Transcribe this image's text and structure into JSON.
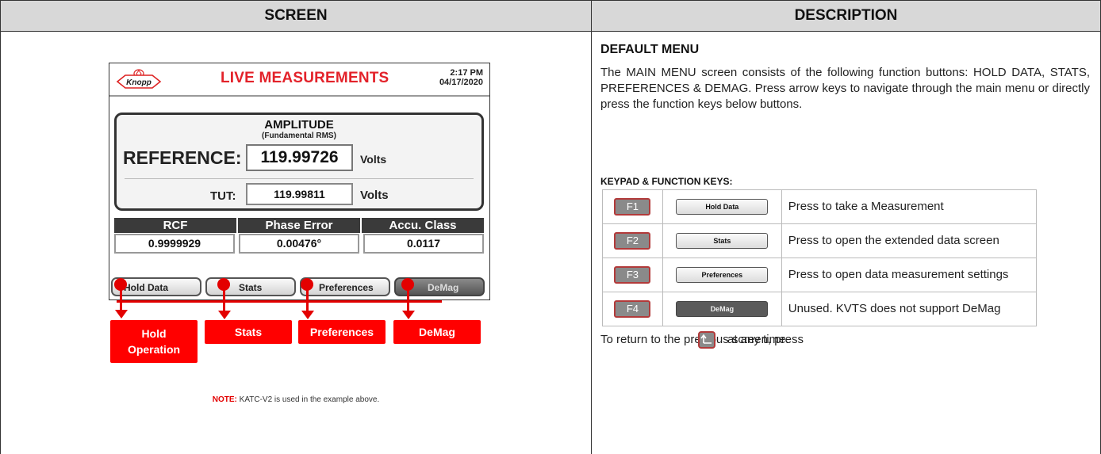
{
  "headers": {
    "screen": "SCREEN",
    "description": "DESCRIPTION"
  },
  "device": {
    "logo_text": "Knopp",
    "title": "LIVE MEASUREMENTS",
    "time": "2:17 PM",
    "date": "04/17/2020",
    "amplitude": {
      "title": "AMPLITUDE",
      "subtitle": "(Fundamental RMS)",
      "reference_label": "REFERENCE:",
      "reference_value": "119.99726",
      "reference_unit": "Volts",
      "tut_label": "TUT:",
      "tut_value": "119.99811",
      "tut_unit": "Volts"
    },
    "metrics": {
      "headers": [
        "RCF",
        "Phase Error",
        "Accu. Class"
      ],
      "values": [
        "0.9999929",
        "0.00476°",
        "0.0117"
      ]
    },
    "buttons": [
      "Hold Data",
      "Stats",
      "Preferences",
      "DeMag"
    ]
  },
  "callouts": {
    "hold_line1": "Hold",
    "hold_line2": "Operation",
    "stats": "Stats",
    "preferences": "Preferences",
    "demag": "DeMag"
  },
  "note": {
    "label": "NOTE:",
    "text": " KATC-V2 is used in the example above."
  },
  "description": {
    "heading": "DEFAULT MENU",
    "paragraph": "The MAIN MENU screen consists of the following function buttons: HOLD DATA, STATS, PREFERENCES & DEMAG.  Press arrow keys to navigate through the main menu or directly press the function keys below buttons.",
    "keypad_heading": "KEYPAD & FUNCTION KEYS:",
    "keys": [
      {
        "key": "F1",
        "button": "Hold Data",
        "text": "Press to take a Measurement"
      },
      {
        "key": "F2",
        "button": "Stats",
        "text": "Press to open the extended data screen"
      },
      {
        "key": "F3",
        "button": "Preferences",
        "text": "Press to open data measurement settings"
      },
      {
        "key": "F4",
        "button": "DeMag",
        "text": "Unused. KVTS does not support DeMag"
      }
    ],
    "return_before": "To return to the previous screen, press",
    "return_after": "at any time."
  }
}
